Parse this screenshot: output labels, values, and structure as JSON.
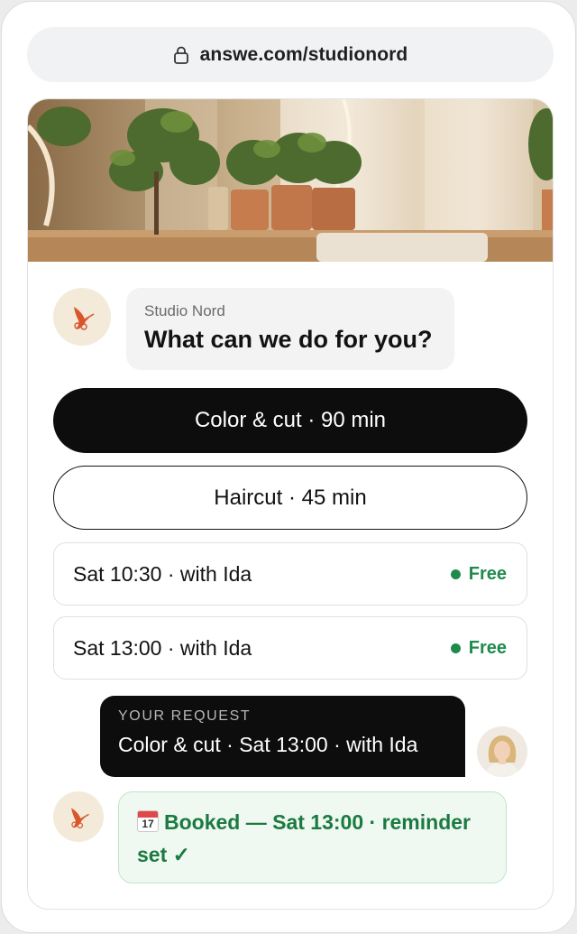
{
  "browser": {
    "url": "answe.com/studionord",
    "lock_icon": "lock-icon"
  },
  "chat": {
    "agent": {
      "name": "Studio Nord",
      "greeting": "What can we do for you?",
      "avatar_icon": "hummingbird-logo-icon"
    },
    "services": [
      {
        "label": "Color & cut · 90 min",
        "selected": true
      },
      {
        "label": "Haircut · 45 min",
        "selected": false
      }
    ],
    "slots": [
      {
        "label": "Sat 10:30 · with Ida",
        "status": "Free"
      },
      {
        "label": "Sat 13:00 · with Ida",
        "status": "Free"
      }
    ],
    "request": {
      "heading": "YOUR REQUEST",
      "text": "Color & cut · Sat 13:00 · with Ida"
    },
    "confirmation": {
      "icon": "calendar-icon",
      "calendar_day": "17",
      "text": "Booked — Sat 13:00 · reminder set ✓"
    }
  },
  "colors": {
    "primary": "#0d0d0d",
    "free_green": "#1e8a4c",
    "confirm_bg": "#eff9f1",
    "brand_avatar_bg": "#f3ead9"
  }
}
